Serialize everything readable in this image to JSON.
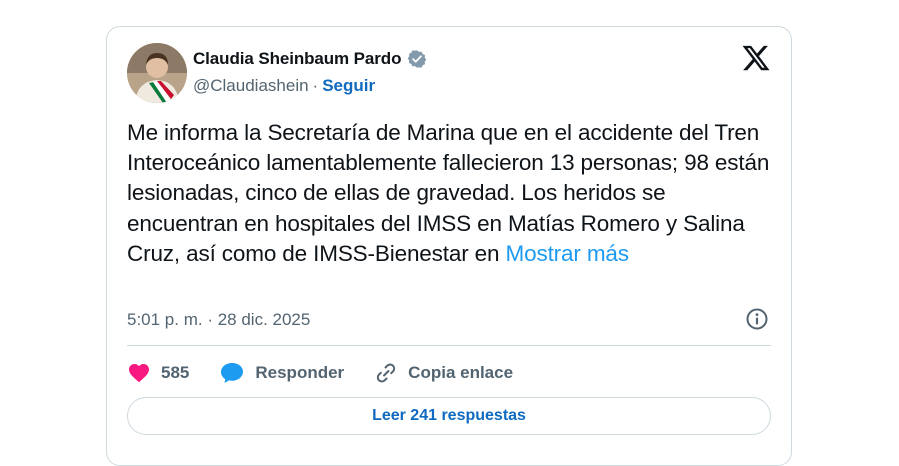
{
  "user": {
    "name": "Claudia Sheinbaum Pardo",
    "handle": "@Claudiashein",
    "separator": "·",
    "follow_label": "Seguir"
  },
  "tweet": {
    "text": "Me informa la Secretaría de Marina que en el accidente del Tren Interoceánico lamentablemente fallecieron 13 personas; 98 están lesionadas, cinco de ellas de gravedad. Los heridos se encuentran en hospitales del IMSS en Matías Romero y Salina Cruz, así como de IMSS-Bienestar en",
    "more_label": "Mostrar más",
    "timestamp": "5:01 p. m. · 28 dic. 2025"
  },
  "actions": {
    "like_count": "585",
    "reply_label": "Responder",
    "copy_label": "Copia enlace"
  },
  "replies_button": "Leer 241 respuestas",
  "colors": {
    "accent": "#1d9bf0",
    "link_dark": "#0f6ac0",
    "like": "#f91880",
    "muted": "#536471",
    "border": "#cfd9de"
  },
  "icons": [
    "avatar-image",
    "verified-badge-icon",
    "x-logo-icon",
    "info-icon",
    "heart-icon",
    "reply-bubble-icon",
    "link-icon"
  ]
}
